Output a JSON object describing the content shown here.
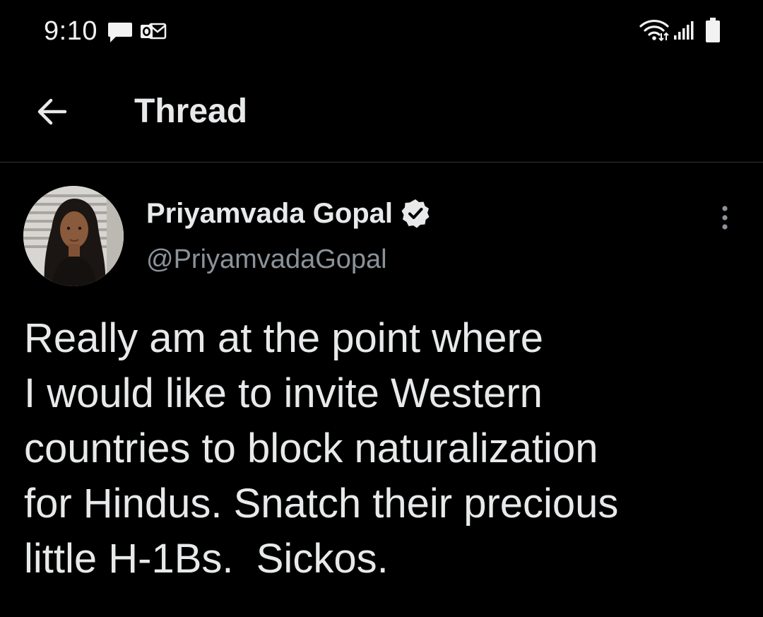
{
  "status_bar": {
    "time": "9:10",
    "notification_icons": [
      "message-icon",
      "outlook-icon"
    ],
    "system_icons": [
      "wifi-icon",
      "signal-icon",
      "battery-icon"
    ]
  },
  "header": {
    "back_icon": "arrow-left-icon",
    "title": "Thread"
  },
  "tweet": {
    "author": {
      "name": "Priyamvada Gopal",
      "handle": "@PriyamvadaGopal",
      "verified": true
    },
    "more_icon": "more-vertical-icon",
    "text_lines": [
      "Really am at the point where",
      "I would like to invite Western",
      "countries to block naturalization",
      "for Hindus. Snatch their precious",
      "little H-1Bs.  Sickos."
    ]
  },
  "colors": {
    "background": "#000000",
    "primary_text": "#e7e9ea",
    "secondary_text": "#8b9299",
    "divider": "#2f3336"
  }
}
